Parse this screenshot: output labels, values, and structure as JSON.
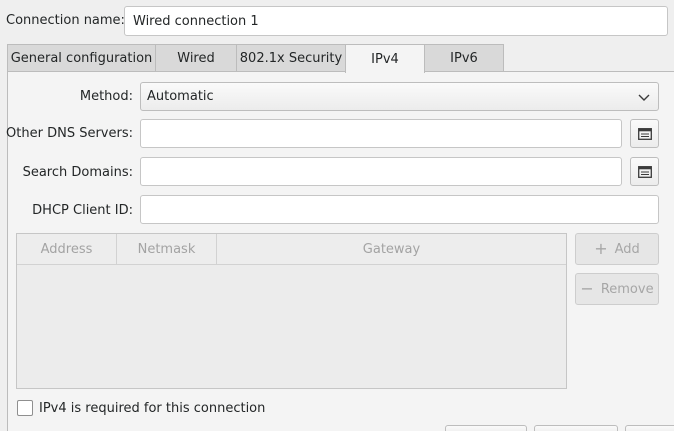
{
  "connection": {
    "name_label": "Connection name:",
    "name_value": "Wired connection 1"
  },
  "tabs": [
    {
      "label": "General configuration",
      "active": false
    },
    {
      "label": "Wired",
      "active": false
    },
    {
      "label": "802.1x Security",
      "active": false
    },
    {
      "label": "IPv4",
      "active": true
    },
    {
      "label": "IPv6",
      "active": false
    }
  ],
  "ipv4": {
    "method_label": "Method:",
    "method_value": "Automatic",
    "dns_label": "Other DNS Servers:",
    "dns_value": "",
    "search_label": "Search Domains:",
    "search_value": "",
    "dhcp_label": "DHCP Client ID:",
    "dhcp_value": "",
    "table": {
      "columns": [
        "Address",
        "Netmask",
        "Gateway"
      ],
      "rows": []
    },
    "add_label": "Add",
    "remove_label": "Remove",
    "required_label": "IPv4 is required for this connection",
    "required_checked": false
  },
  "icons": {
    "method_dropdown": "chevron-down-icon",
    "dns_edit": "list-edit-icon",
    "search_edit": "list-edit-icon",
    "add": "plus-icon",
    "remove": "minus-icon"
  }
}
